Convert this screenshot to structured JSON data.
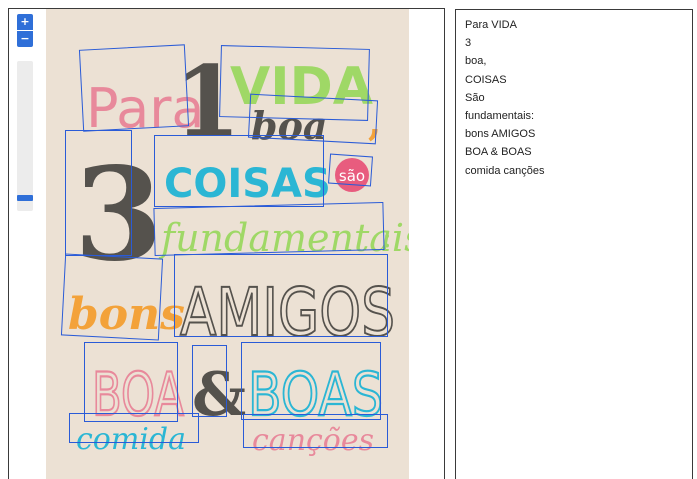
{
  "viewer": {
    "zoom_in_label": "+",
    "zoom_out_label": "−",
    "zoom_level": 0.93
  },
  "poster": {
    "background_color": "#ece1d4",
    "words": {
      "para": "Para",
      "one": "1",
      "vida": "VIDA",
      "boa_comma": "boa",
      "comma": ",",
      "three": "3",
      "coisas": "COISAS",
      "sao": "são",
      "fundamentais": "fundamentais",
      "colon": ":",
      "bons": "bons",
      "amigos": "AMIGOS",
      "boa_upper": "BOA",
      "ampersand": "&",
      "boas_upper": "BOAS",
      "comida": "comida",
      "cancoes": "canções"
    },
    "colors": {
      "pink": "#e8899b",
      "green": "#9fd866",
      "dark": "#55524d",
      "teal": "#2bb6d4",
      "orange": "#f3a23a",
      "sao_badge": "#e85c7e",
      "box": "#2a5bd7"
    }
  },
  "ocr_lines": [
    "Para VIDA",
    "3",
    "boa,",
    "COISAS",
    "São",
    "fundamentais:",
    "bons AMIGOS",
    "BOA & BOAS",
    "comida canções"
  ]
}
